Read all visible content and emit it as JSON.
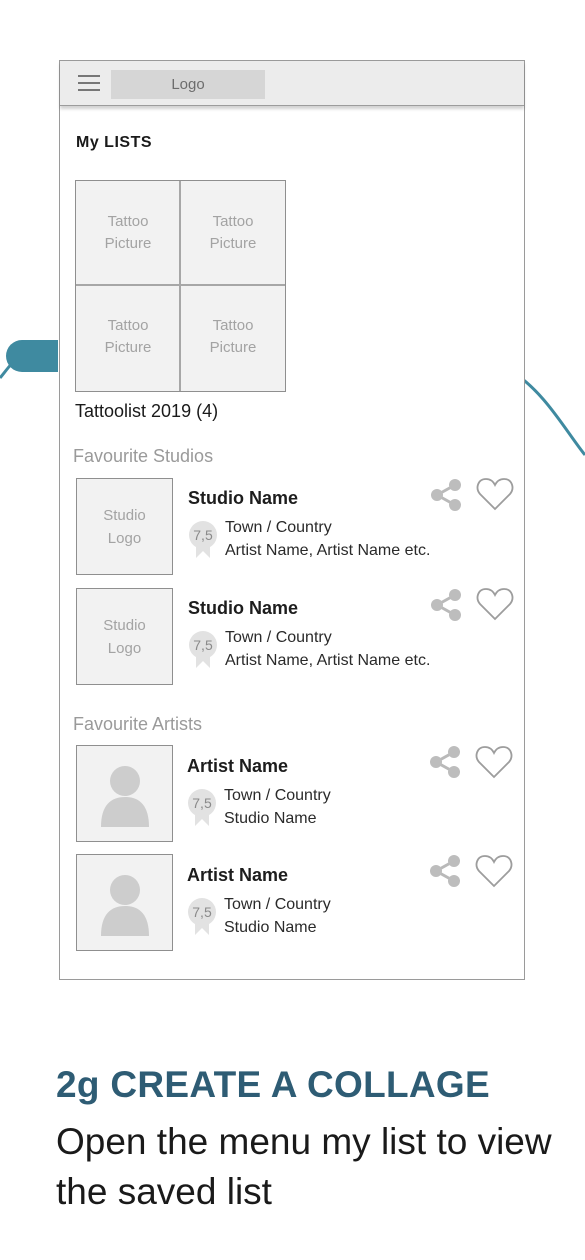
{
  "header": {
    "logo": "Logo"
  },
  "my_lists": {
    "heading": "My LISTS",
    "collage_tiles": [
      "Tattoo\nPicture",
      "Tattoo\nPicture",
      "Tattoo\nPicture",
      "Tattoo\nPicture"
    ],
    "list_title": "Tattoolist 2019 (4)"
  },
  "studios": {
    "heading": "Favourite Studios",
    "items": [
      {
        "logo": "Studio\nLogo",
        "name": "Studio Name",
        "rating": "7,5",
        "location": "Town / Country",
        "artists": "Artist Name, Artist Name etc."
      },
      {
        "logo": "Studio\nLogo",
        "name": "Studio Name",
        "rating": "7,5",
        "location": "Town / Country",
        "artists": "Artist Name, Artist Name etc."
      }
    ]
  },
  "artists": {
    "heading": "Favourite Artists",
    "items": [
      {
        "name": "Artist Name",
        "rating": "7,5",
        "location": "Town / Country",
        "studio": "Studio Name"
      },
      {
        "name": "Artist Name",
        "rating": "7,5",
        "location": "Town / Country",
        "studio": "Studio Name"
      }
    ]
  },
  "caption": {
    "title": "2g CREATE A COLLAGE",
    "text": "Open the menu my list to view the saved list"
  },
  "colors": {
    "accent": "#2e5c74",
    "connector": "#3f8aa0",
    "placeholder": "#f2f2f2"
  },
  "icons": [
    "hamburger-menu-icon",
    "share-icon",
    "heart-icon",
    "rating-badge-icon",
    "person-silhouette-icon"
  ]
}
